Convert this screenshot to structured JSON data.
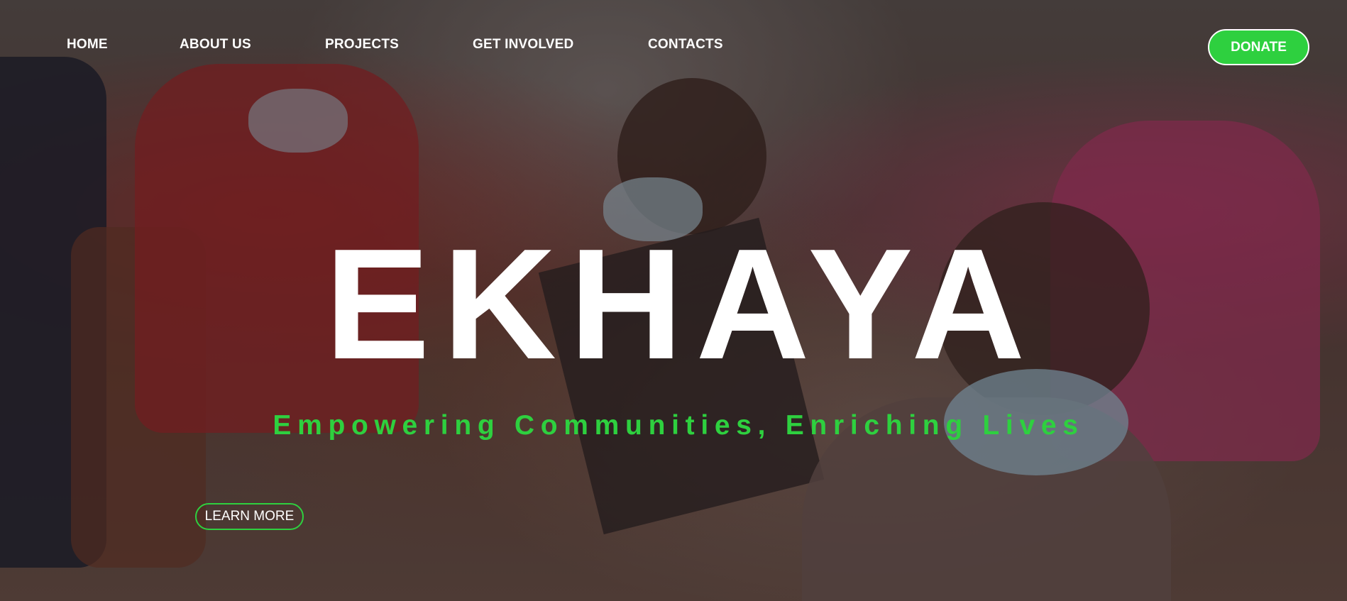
{
  "nav": {
    "items": [
      {
        "label": "HOME"
      },
      {
        "label": "ABOUT US"
      },
      {
        "label": "PROJECTS"
      },
      {
        "label": "GET INVOLVED"
      },
      {
        "label": "CONTACTS"
      }
    ],
    "donate_label": "DONATE"
  },
  "hero": {
    "title": "EKHAYA",
    "tagline": "Empowering Communities, Enriching Lives",
    "cta_label": "LEARN MORE",
    "background_image": "photo of children wearing face masks holding books"
  },
  "colors": {
    "accent": "#2ed03f",
    "text": "#ffffff"
  }
}
